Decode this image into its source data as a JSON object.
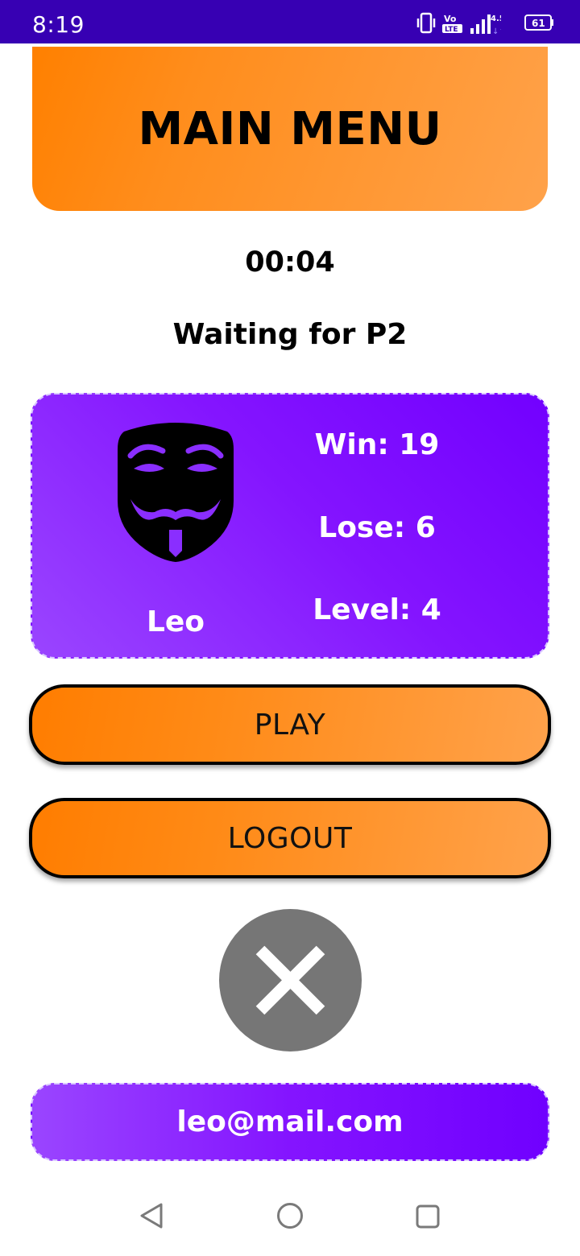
{
  "status_bar": {
    "time": "8:19",
    "network_label": "4.5G",
    "volte_label": "Vo",
    "lte_label": "LTE",
    "battery_level": "61"
  },
  "header": {
    "title": "MAIN MENU"
  },
  "timer": "00:04",
  "waiting_text": "Waiting for P2",
  "profile": {
    "name": "Leo",
    "win_text": "Win: 19",
    "lose_text": "Lose: 6",
    "level_text": "Level: 4",
    "avatar_icon": "guy-fawkes-mask-icon"
  },
  "buttons": {
    "play_label": "PLAY",
    "logout_label": "LOGOUT",
    "close_icon": "close-icon"
  },
  "email": "leo@mail.com",
  "nav": {
    "back_icon": "back-icon",
    "home_icon": "home-icon",
    "recents_icon": "recents-icon"
  },
  "colors": {
    "status_bar": "#3700b3",
    "orange_accent": "#ff8000",
    "purple_accent": "#7200ff",
    "close_button": "#767676"
  }
}
